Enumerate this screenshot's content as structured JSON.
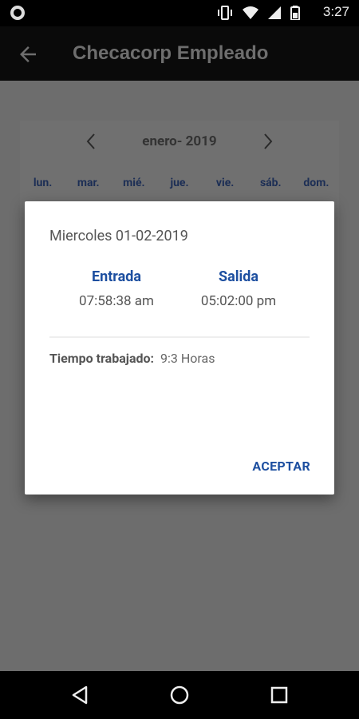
{
  "status_bar": {
    "time": "3:27",
    "icons": [
      "notification-dot-icon",
      "vibrate-icon",
      "wifi-icon",
      "signal-icon",
      "battery-icon"
    ]
  },
  "app_bar": {
    "title": "Checacorp Empleado",
    "back_icon": "arrow-left-icon"
  },
  "calendar": {
    "month_label": "enero- 2019",
    "weekdays": [
      "lun.",
      "mar.",
      "mié.",
      "jue.",
      "vie.",
      "sáb.",
      "dom."
    ]
  },
  "dialog": {
    "date": "Miercoles 01-02-2019",
    "entrada_label": "Entrada",
    "entrada_value": "07:58:38 am",
    "salida_label": "Salida",
    "salida_value": "05:02:00 pm",
    "worked_label": "Tiempo trabajado:",
    "worked_value": "9:3 Horas",
    "accept_label": "ACEPTAR"
  },
  "colors": {
    "accent": "#1d4fa0",
    "overlay": "#6d6d6d"
  }
}
